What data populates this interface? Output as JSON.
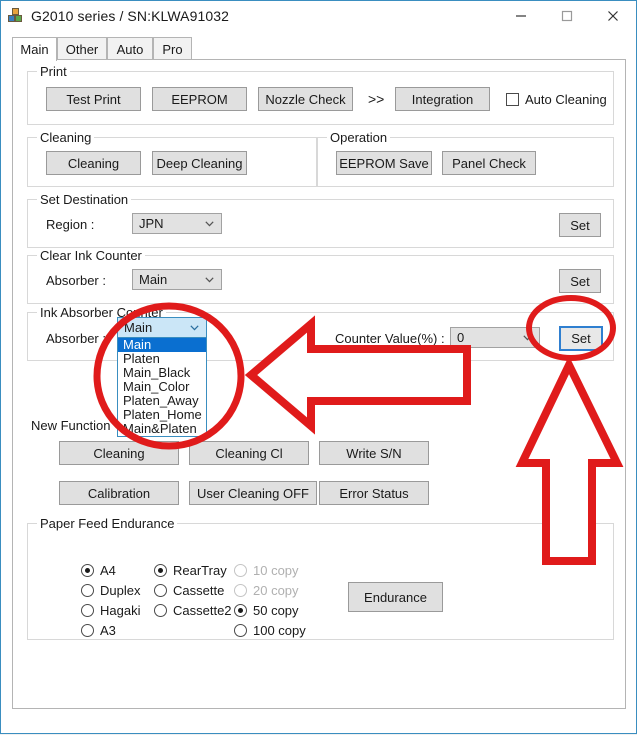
{
  "window": {
    "title": "G2010 series / SN:KLWA91032",
    "icon": "blocks-icon",
    "controls": {
      "minimize": "minimize-icon",
      "maximize": "maximize-icon",
      "close": "close-icon"
    }
  },
  "tabs": [
    {
      "label": "Main",
      "active": true
    },
    {
      "label": "Other",
      "active": false
    },
    {
      "label": "Auto",
      "active": false
    },
    {
      "label": "Pro",
      "active": false
    }
  ],
  "print_group": {
    "legend": "Print",
    "buttons": [
      "Test Print",
      "EEPROM",
      "Nozzle Check",
      "Integration"
    ],
    "separator": ">>",
    "auto_cleaning": {
      "label": "Auto Cleaning",
      "checked": false
    }
  },
  "cleaning_group": {
    "legend": "Cleaning",
    "buttons": [
      "Cleaning",
      "Deep Cleaning"
    ]
  },
  "operation_group": {
    "legend": "Operation",
    "buttons": [
      "EEPROM Save",
      "Panel Check"
    ]
  },
  "set_destination_group": {
    "legend": "Set Destination",
    "region_label": "Region :",
    "region_value": "JPN",
    "set_label": "Set"
  },
  "clear_ink_counter_group": {
    "legend": "Clear Ink Counter",
    "absorber_label": "Absorber :",
    "absorber_value": "Main",
    "set_label": "Set"
  },
  "ink_absorber_counter_group": {
    "legend": "Ink Absorber Counter",
    "absorber_label": "Absorber :",
    "absorber_value": "Main",
    "absorber_options": [
      "Main",
      "Platen",
      "Main_Black",
      "Main_Color",
      "Platen_Away",
      "Platen_Home",
      "Main&Platen"
    ],
    "absorber_selected_index": 0,
    "counter_value_label": "Counter Value(%) :",
    "counter_value": "0",
    "set_label": "Set",
    "set_focused": true
  },
  "new_function": {
    "label": "New Function",
    "buttons": [
      "Cleaning",
      "Cleaning Cl",
      "Write S/N",
      "Calibration",
      "User Cleaning OFF",
      "Error Status"
    ]
  },
  "paper_feed_group": {
    "legend": "Paper Feed Endurance",
    "paper_sizes": [
      {
        "label": "A4",
        "selected": true,
        "disabled": false
      },
      {
        "label": "Duplex",
        "selected": false,
        "disabled": false
      },
      {
        "label": "Hagaki",
        "selected": false,
        "disabled": false
      },
      {
        "label": "A3",
        "selected": false,
        "disabled": false
      }
    ],
    "sources": [
      {
        "label": "RearTray",
        "selected": true,
        "disabled": false
      },
      {
        "label": "Cassette",
        "selected": false,
        "disabled": false
      },
      {
        "label": "Cassette2",
        "selected": false,
        "disabled": false
      }
    ],
    "copies": [
      {
        "label": "10 copy",
        "selected": false,
        "disabled": true
      },
      {
        "label": "20 copy",
        "selected": false,
        "disabled": true
      },
      {
        "label": "50 copy",
        "selected": true,
        "disabled": false
      },
      {
        "label": "100 copy",
        "selected": false,
        "disabled": false
      }
    ],
    "endurance_button": "Endurance"
  },
  "annotations": {
    "color": "#e01b1b",
    "shapes": [
      "ellipse-around-absorber-dropdown",
      "ellipse-around-set-button",
      "left-pointing-arrow",
      "up-pointing-arrow"
    ]
  }
}
